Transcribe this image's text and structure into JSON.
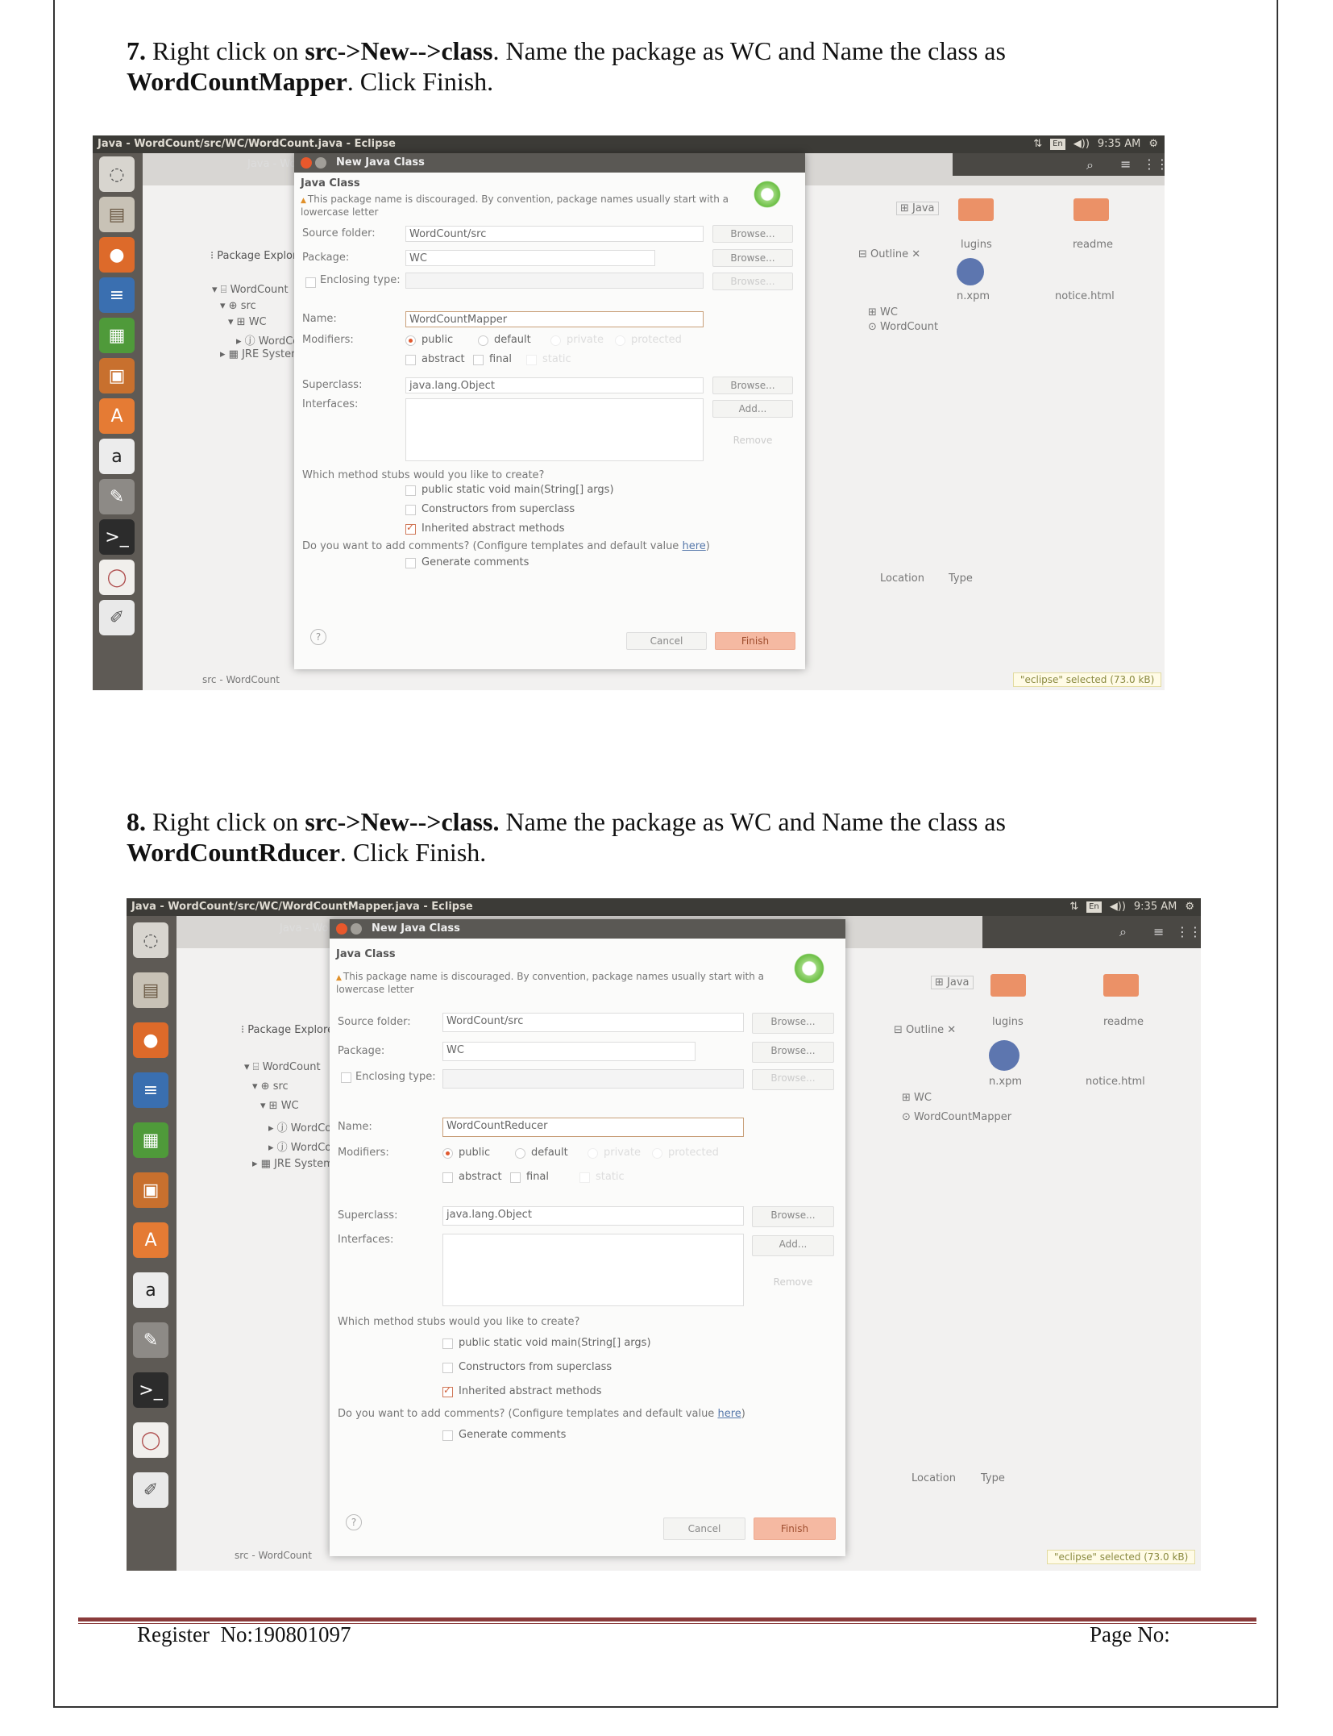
{
  "steps": [
    {
      "number": "7.",
      "text_a": " Right click on ",
      "cmd1": "src->New-->class",
      "text_b": ". Name the package as WC and Name the class as",
      "classname": "WordCountMapper",
      "text_c": ". Click Finish."
    },
    {
      "number": "8.",
      "text_a": " Right click on ",
      "cmd1": "src->New-->class.",
      "text_b": " Name the package as WC and Name the class as",
      "classname": "WordCountRducer",
      "text_c": ". Click Finish."
    }
  ],
  "screenshots": [
    {
      "window_title": "Java - WordCount/src/WC/WordCount.java - Eclipse",
      "tray": {
        "lang": "En",
        "volume": "◀))",
        "time": "9:35 AM"
      },
      "bg_window_tab": "Java - WordCou",
      "dialog": {
        "title": "New Java Class",
        "section": "Java Class",
        "warning": "This package name is discouraged. By convention, package names usually start with a lowercase letter",
        "source_folder_label": "Source folder:",
        "source_folder_value": "WordCount/src",
        "package_label": "Package:",
        "package_value": "WC",
        "enclosing_label": "Enclosing type:",
        "name_label": "Name:",
        "name_value": "WordCountMapper",
        "modifiers_label": "Modifiers:",
        "mod_public": "public",
        "mod_default": "default",
        "mod_private": "private",
        "mod_protected": "protected",
        "mod_abstract": "abstract",
        "mod_final": "final",
        "mod_static": "static",
        "superclass_label": "Superclass:",
        "superclass_value": "java.lang.Object",
        "interfaces_label": "Interfaces:",
        "browse": "Browse...",
        "add": "Add...",
        "remove": "Remove",
        "stubs_question": "Which method stubs would you like to create?",
        "stub_main": "public static void main(String[] args)",
        "stub_ctor": "Constructors from superclass",
        "stub_inherited": "Inherited abstract methods",
        "comments_question": "Do you want to add comments? (Configure templates and default value ",
        "comments_link": "here",
        "comments_close": ")",
        "generate_comments": "Generate comments",
        "help": "?",
        "cancel": "Cancel",
        "finish": "Finish"
      },
      "package_explorer": {
        "title": "Package Explorer",
        "tree": [
          "WordCount",
          "src",
          "WC",
          "WordCount.java",
          "JRE System Library"
        ]
      },
      "outline": {
        "title": "Outline",
        "items": [
          "WC",
          "WordCount"
        ]
      },
      "perspective": "Java",
      "files": [
        "lugins",
        "readme",
        "n.xpm",
        "notice.html"
      ],
      "bottom_cols": [
        "Location",
        "Type"
      ],
      "status_left": "src - WordCount",
      "status_right": "\"eclipse\" selected (73.0 kB)"
    },
    {
      "window_title": "Java - WordCount/src/WC/WordCountMapper.java - Eclipse",
      "tray": {
        "lang": "En",
        "volume": "◀))",
        "time": "9:35 AM"
      },
      "bg_window_tab": "Java - WordCou",
      "dialog": {
        "title": "New Java Class",
        "section": "Java Class",
        "warning": "This package name is discouraged. By convention, package names usually start with a lowercase letter",
        "source_folder_label": "Source folder:",
        "source_folder_value": "WordCount/src",
        "package_label": "Package:",
        "package_value": "WC",
        "enclosing_label": "Enclosing type:",
        "name_label": "Name:",
        "name_value": "WordCountReducer",
        "modifiers_label": "Modifiers:",
        "mod_public": "public",
        "mod_default": "default",
        "mod_private": "private",
        "mod_protected": "protected",
        "mod_abstract": "abstract",
        "mod_final": "final",
        "mod_static": "static",
        "superclass_label": "Superclass:",
        "superclass_value": "java.lang.Object",
        "interfaces_label": "Interfaces:",
        "browse": "Browse...",
        "add": "Add...",
        "remove": "Remove",
        "stubs_question": "Which method stubs would you like to create?",
        "stub_main": "public static void main(String[] args)",
        "stub_ctor": "Constructors from superclass",
        "stub_inherited": "Inherited abstract methods",
        "comments_question": "Do you want to add comments? (Configure templates and default value ",
        "comments_link": "here",
        "comments_close": ")",
        "generate_comments": "Generate comments",
        "help": "?",
        "cancel": "Cancel",
        "finish": "Finish"
      },
      "package_explorer": {
        "title": "Package Explorer",
        "tree": [
          "WordCount",
          "src",
          "WC",
          "WordCount.java",
          "WordCountMap",
          "JRE System Library"
        ]
      },
      "outline": {
        "title": "Outline",
        "items": [
          "WC",
          "WordCountMapper"
        ]
      },
      "perspective": "Java",
      "files": [
        "lugins",
        "readme",
        "n.xpm",
        "notice.html"
      ],
      "bottom_cols": [
        "Location",
        "Type"
      ],
      "status_left": "src - WordCount",
      "status_right": "\"eclipse\" selected (73.0 kB)"
    }
  ],
  "footer": {
    "register": "Register  No:190801097",
    "page": "Page No:"
  }
}
